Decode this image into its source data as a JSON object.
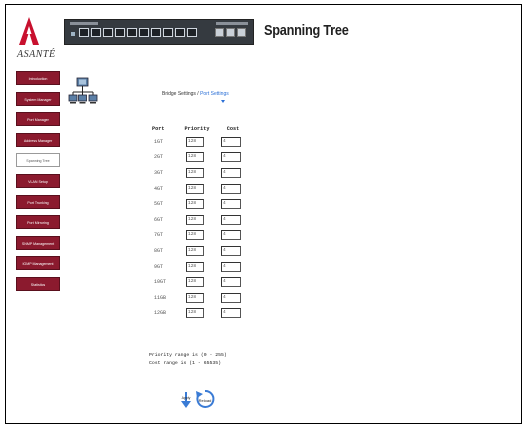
{
  "brand": {
    "name": "ASANTÉ"
  },
  "page": {
    "title": "Spanning Tree"
  },
  "sidebar": {
    "items": [
      {
        "label": "Introduction",
        "active": false
      },
      {
        "label": "System Manager",
        "active": false
      },
      {
        "label": "Port Manager",
        "active": false
      },
      {
        "label": "Address Manager",
        "active": false
      },
      {
        "label": "Spanning Tree",
        "active": true
      },
      {
        "label": "VLAN Setup",
        "active": false
      },
      {
        "label": "Port Trunking",
        "active": false
      },
      {
        "label": "Port Mirroring",
        "active": false
      },
      {
        "label": "SNMP Management",
        "active": false
      },
      {
        "label": "IGMP Management",
        "active": false
      },
      {
        "label": "Statistics",
        "active": false
      }
    ]
  },
  "breadcrumb": {
    "bridge": "Bridge Settings",
    "separator": " / ",
    "port": "Port Settings"
  },
  "table": {
    "headers": {
      "port": "Port",
      "priority": "Priority",
      "cost": "Cost"
    },
    "rows": [
      {
        "port": "1GT",
        "priority": "128",
        "cost": "4"
      },
      {
        "port": "2GT",
        "priority": "128",
        "cost": "4"
      },
      {
        "port": "3GT",
        "priority": "128",
        "cost": "4"
      },
      {
        "port": "4GT",
        "priority": "128",
        "cost": "4"
      },
      {
        "port": "5GT",
        "priority": "128",
        "cost": "4"
      },
      {
        "port": "6GT",
        "priority": "128",
        "cost": "4"
      },
      {
        "port": "7GT",
        "priority": "128",
        "cost": "4"
      },
      {
        "port": "8GT",
        "priority": "128",
        "cost": "4"
      },
      {
        "port": "9GT",
        "priority": "128",
        "cost": "4"
      },
      {
        "port": "10GT",
        "priority": "128",
        "cost": "4"
      },
      {
        "port": "11GB",
        "priority": "128",
        "cost": "4"
      },
      {
        "port": "12GB",
        "priority": "128",
        "cost": "4"
      }
    ]
  },
  "hints": {
    "priority_range": "Priority range is (0 - 255)",
    "cost_range": "Cost range is (1 - 65535)"
  },
  "actions": {
    "apply_label": "Apply",
    "reload_label": "Reload"
  },
  "colors": {
    "sidebar_bg": "#8b1a2e",
    "link": "#2a6fd6",
    "switch_body": "#353a40"
  }
}
